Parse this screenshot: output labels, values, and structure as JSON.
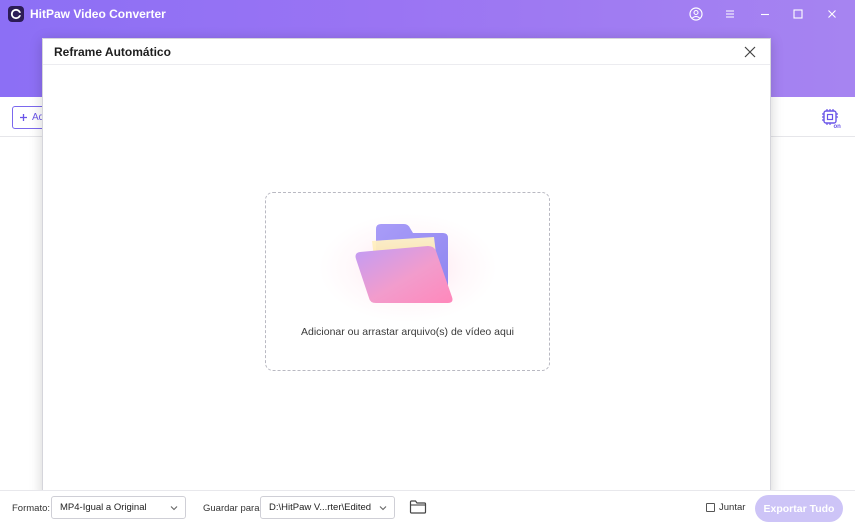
{
  "window": {
    "title": "HitPaw Video Converter",
    "icons": [
      "account-icon",
      "menu-icon",
      "minimize-icon",
      "maximize-icon",
      "close-icon"
    ]
  },
  "toolbar": {
    "add_label": "Ad",
    "hw_accel_icon": "hardware-acceleration-icon"
  },
  "modal": {
    "title": "Reframe Automático",
    "drop_text": "Adicionar ou arrastar arquivo(s) de vídeo aqui"
  },
  "bottom": {
    "format_label": "Formato:",
    "format_value": "MP4-Igual a Original",
    "save_label": "Guardar para:",
    "save_path": "D:\\HitPaw V...rter\\Edited",
    "merge_label": "Juntar",
    "export_label": "Exportar Tudo"
  },
  "colors": {
    "header_start": "#8c6ff5",
    "header_end": "#a684f1",
    "accent": "#6a55e8",
    "export_disabled": "#cdc4f7"
  }
}
